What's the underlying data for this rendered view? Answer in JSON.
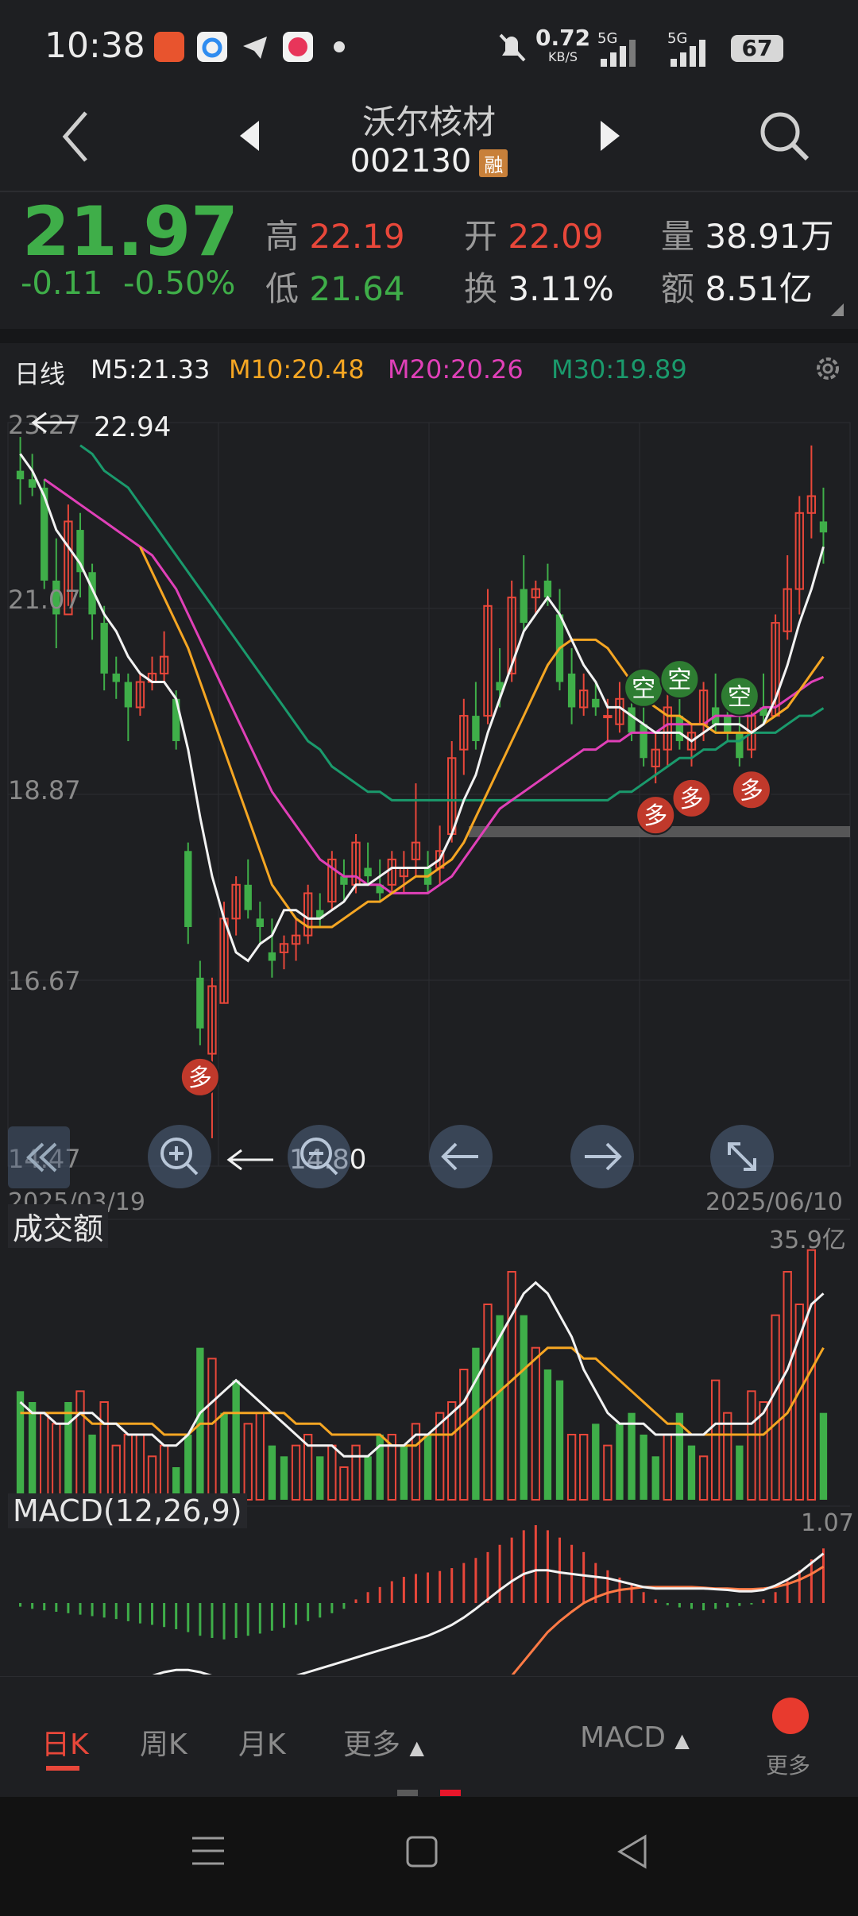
{
  "status": {
    "time": "10:38",
    "net_speed": "0.72",
    "net_unit": "KB/S",
    "signal_1": "5G",
    "signal_2": "5G",
    "battery": "67",
    "icons": [
      "pingan-securities-app-icon",
      "cloud-app-icon",
      "telegram-app-icon",
      "chat-app-icon",
      "dot-icon",
      "mute-bell-icon",
      "signal-icon",
      "signal-icon"
    ]
  },
  "header": {
    "stock_name": "沃尔核材",
    "stock_code": "002130",
    "badge": "融"
  },
  "quote": {
    "price": "21.97",
    "change": "-0.11",
    "change_pct": "-0.50%",
    "high_label": "高",
    "high": "22.19",
    "low_label": "低",
    "low": "21.64",
    "open_label": "开",
    "open": "22.09",
    "turnover_label": "换",
    "turnover": "3.11%",
    "volume_label": "量",
    "volume": "38.91万",
    "amount_label": "额",
    "amount": "8.51亿"
  },
  "ma_bar": {
    "period": "日线",
    "m5": "M5:21.33",
    "m10": "M10:20.48",
    "m20": "M20:20.26",
    "m30": "M30:19.89",
    "colors": {
      "m5": "#f2f2f2",
      "m10": "#f5a623",
      "m20": "#e040b8",
      "m30": "#1a9a6c"
    }
  },
  "chart_data": {
    "type": "candlestick",
    "y_ticks": [
      "23.27",
      "21.07",
      "18.87",
      "16.67",
      "14.47"
    ],
    "ylim": [
      14.47,
      23.27
    ],
    "date_start": "2025/03/19",
    "date_end": "2025/06/10",
    "max_label": "22.94",
    "min_label": "14.80",
    "signal_duo": "多",
    "signal_kong": "空",
    "candles": [
      [
        22.7,
        23.1,
        22.3,
        22.6
      ],
      [
        22.6,
        22.9,
        22.4,
        22.5
      ],
      [
        22.5,
        22.6,
        21.3,
        21.4
      ],
      [
        21.4,
        21.9,
        20.6,
        21.0
      ],
      [
        21.0,
        22.3,
        21.1,
        22.1
      ],
      [
        22.0,
        22.2,
        21.2,
        21.5
      ],
      [
        21.5,
        21.6,
        20.7,
        21.0
      ],
      [
        20.9,
        21.1,
        20.1,
        20.3
      ],
      [
        20.3,
        20.5,
        20.0,
        20.2
      ],
      [
        20.2,
        20.3,
        19.5,
        19.9
      ],
      [
        19.9,
        20.3,
        19.8,
        20.2
      ],
      [
        20.2,
        20.5,
        20.1,
        20.3
      ],
      [
        20.3,
        20.8,
        20.2,
        20.5
      ],
      [
        20.0,
        20.1,
        19.4,
        19.5
      ],
      [
        18.2,
        18.3,
        17.1,
        17.3
      ],
      [
        16.7,
        16.9,
        15.9,
        16.1
      ],
      [
        15.8,
        16.7,
        14.8,
        16.6
      ],
      [
        16.4,
        17.6,
        16.4,
        17.4
      ],
      [
        17.4,
        17.9,
        17.2,
        17.8
      ],
      [
        17.8,
        18.1,
        17.4,
        17.5
      ],
      [
        17.4,
        17.6,
        17.1,
        17.3
      ],
      [
        17.0,
        17.4,
        16.7,
        16.9
      ],
      [
        17.0,
        17.2,
        16.8,
        17.1
      ],
      [
        17.1,
        17.4,
        16.9,
        17.2
      ],
      [
        17.2,
        17.8,
        17.1,
        17.7
      ],
      [
        17.5,
        17.7,
        17.3,
        17.4
      ],
      [
        17.6,
        18.2,
        17.5,
        18.1
      ],
      [
        17.9,
        18.1,
        17.6,
        17.8
      ],
      [
        17.8,
        18.4,
        17.7,
        18.3
      ],
      [
        18.0,
        18.3,
        17.8,
        17.9
      ],
      [
        17.8,
        18.1,
        17.6,
        17.7
      ],
      [
        17.8,
        18.2,
        17.7,
        18.1
      ],
      [
        17.9,
        18.2,
        17.7,
        18.0
      ],
      [
        18.1,
        19.0,
        17.9,
        18.3
      ],
      [
        18.0,
        18.2,
        17.7,
        17.8
      ],
      [
        18.0,
        18.5,
        17.8,
        18.2
      ],
      [
        18.4,
        19.5,
        18.3,
        19.3
      ],
      [
        19.4,
        20.0,
        19.1,
        19.8
      ],
      [
        19.8,
        20.2,
        19.4,
        19.5
      ],
      [
        19.8,
        21.3,
        19.7,
        21.1
      ],
      [
        20.2,
        20.6,
        19.9,
        20.1
      ],
      [
        20.3,
        21.4,
        20.2,
        21.2
      ],
      [
        21.3,
        21.7,
        20.8,
        20.9
      ],
      [
        21.2,
        21.4,
        21.0,
        21.3
      ],
      [
        21.4,
        21.6,
        21.1,
        21.2
      ],
      [
        21.0,
        21.3,
        20.1,
        20.2
      ],
      [
        20.3,
        20.6,
        19.7,
        19.9
      ],
      [
        19.9,
        20.3,
        19.8,
        20.1
      ],
      [
        20.0,
        20.2,
        19.8,
        19.9
      ],
      [
        19.8,
        20.0,
        19.5,
        19.8
      ],
      [
        19.7,
        20.2,
        19.6,
        20.0
      ],
      [
        19.9,
        20.3,
        19.5,
        19.6
      ],
      [
        19.7,
        20.0,
        19.2,
        19.3
      ],
      [
        19.2,
        19.6,
        19.0,
        19.4
      ],
      [
        19.4,
        20.1,
        19.2,
        19.9
      ],
      [
        19.8,
        20.1,
        19.4,
        19.5
      ],
      [
        19.4,
        19.7,
        19.2,
        19.6
      ],
      [
        19.7,
        20.2,
        19.5,
        20.1
      ],
      [
        19.9,
        20.3,
        19.6,
        19.7
      ],
      [
        19.8,
        20.1,
        19.5,
        19.6
      ],
      [
        19.6,
        19.9,
        19.2,
        19.3
      ],
      [
        19.4,
        19.9,
        19.3,
        19.8
      ],
      [
        19.9,
        20.3,
        19.7,
        19.8
      ],
      [
        19.8,
        21.0,
        19.8,
        20.9
      ],
      [
        20.8,
        21.7,
        20.7,
        21.3
      ],
      [
        21.3,
        22.4,
        21.0,
        22.2
      ],
      [
        22.2,
        23.0,
        21.9,
        22.4
      ],
      [
        22.1,
        22.5,
        21.6,
        21.97
      ]
    ],
    "ma5": [
      22.9,
      22.7,
      22.4,
      22.0,
      21.8,
      21.6,
      21.3,
      21.0,
      20.8,
      20.5,
      20.3,
      20.2,
      20.2,
      20.0,
      19.4,
      18.6,
      17.9,
      17.4,
      17.0,
      16.9,
      17.1,
      17.2,
      17.5,
      17.5,
      17.4,
      17.4,
      17.5,
      17.6,
      17.8,
      17.8,
      17.9,
      18.0,
      18.0,
      18.0,
      18.0,
      18.1,
      18.4,
      18.8,
      19.1,
      19.6,
      20.0,
      20.4,
      20.8,
      21.0,
      21.2,
      21.0,
      20.7,
      20.4,
      20.2,
      19.9,
      19.9,
      19.8,
      19.7,
      19.6,
      19.6,
      19.6,
      19.5,
      19.6,
      19.7,
      19.7,
      19.7,
      19.6,
      19.7,
      20.0,
      20.4,
      20.9,
      21.3,
      21.8
    ],
    "ma10": [
      null,
      null,
      null,
      null,
      null,
      null,
      null,
      null,
      null,
      null,
      21.8,
      21.5,
      21.2,
      20.9,
      20.6,
      20.2,
      19.8,
      19.4,
      19.0,
      18.6,
      18.2,
      17.8,
      17.6,
      17.4,
      17.3,
      17.3,
      17.3,
      17.4,
      17.5,
      17.6,
      17.6,
      17.7,
      17.8,
      17.9,
      17.9,
      18.0,
      18.1,
      18.3,
      18.6,
      18.9,
      19.2,
      19.5,
      19.8,
      20.1,
      20.4,
      20.6,
      20.7,
      20.7,
      20.7,
      20.6,
      20.4,
      20.2,
      20.0,
      19.9,
      19.8,
      19.8,
      19.7,
      19.7,
      19.6,
      19.6,
      19.6,
      19.6,
      19.7,
      19.8,
      19.9,
      20.1,
      20.3,
      20.5
    ],
    "ma20": [
      null,
      null,
      22.6,
      22.5,
      22.4,
      22.3,
      22.2,
      22.1,
      22.0,
      21.9,
      21.8,
      21.7,
      21.5,
      21.3,
      21.0,
      20.7,
      20.4,
      20.1,
      19.8,
      19.5,
      19.2,
      18.9,
      18.7,
      18.5,
      18.3,
      18.1,
      18.0,
      17.9,
      17.9,
      17.8,
      17.8,
      17.7,
      17.7,
      17.7,
      17.7,
      17.8,
      17.9,
      18.1,
      18.3,
      18.5,
      18.7,
      18.8,
      18.9,
      19.0,
      19.1,
      19.2,
      19.3,
      19.4,
      19.4,
      19.5,
      19.5,
      19.6,
      19.6,
      19.6,
      19.7,
      19.7,
      19.7,
      19.7,
      19.8,
      19.8,
      19.8,
      19.8,
      19.9,
      19.9,
      20.0,
      20.1,
      20.2,
      20.26
    ],
    "ma30": [
      null,
      null,
      null,
      null,
      null,
      23.0,
      22.9,
      22.7,
      22.6,
      22.5,
      22.3,
      22.1,
      21.9,
      21.7,
      21.5,
      21.3,
      21.1,
      20.9,
      20.7,
      20.5,
      20.3,
      20.1,
      19.9,
      19.7,
      19.5,
      19.4,
      19.2,
      19.1,
      19.0,
      18.9,
      18.9,
      18.8,
      18.8,
      18.8,
      18.8,
      18.8,
      18.8,
      18.8,
      18.8,
      18.8,
      18.8,
      18.8,
      18.8,
      18.8,
      18.8,
      18.8,
      18.8,
      18.8,
      18.8,
      18.8,
      18.9,
      18.9,
      19.0,
      19.1,
      19.2,
      19.3,
      19.3,
      19.4,
      19.4,
      19.5,
      19.5,
      19.6,
      19.6,
      19.6,
      19.7,
      19.8,
      19.8,
      19.89
    ],
    "signals": [
      {
        "type": "duo",
        "index": 15
      },
      {
        "type": "duo",
        "index": 53
      },
      {
        "type": "duo",
        "index": 56
      },
      {
        "type": "duo",
        "index": 61
      },
      {
        "type": "kong",
        "index": 52
      },
      {
        "type": "kong",
        "index": 55
      },
      {
        "type": "kong",
        "index": 60
      }
    ]
  },
  "volume_panel": {
    "title": "成交额",
    "max_label": "35.9亿",
    "bars": [
      10,
      9,
      8,
      7,
      9,
      10,
      6,
      9,
      5,
      6,
      6,
      4,
      5,
      3,
      6,
      14,
      13,
      8,
      11,
      7,
      8,
      5,
      4,
      5,
      6,
      4,
      5,
      3,
      5,
      4,
      6,
      6,
      5,
      7,
      6,
      8,
      9,
      12,
      14,
      18,
      17,
      21,
      17,
      14,
      12,
      11,
      6,
      6,
      7,
      5,
      7,
      8,
      6,
      4,
      6,
      8,
      5,
      4,
      11,
      8,
      5,
      10,
      9,
      17,
      21,
      18,
      23,
      8
    ],
    "bar_up": [
      0,
      0,
      1,
      1,
      0,
      1,
      0,
      1,
      1,
      1,
      1,
      1,
      1,
      0,
      0,
      0,
      1,
      0,
      0,
      1,
      1,
      0,
      0,
      1,
      1,
      0,
      1,
      1,
      1,
      0,
      0,
      1,
      0,
      1,
      0,
      1,
      1,
      1,
      0,
      1,
      0,
      1,
      0,
      1,
      0,
      0,
      1,
      1,
      0,
      1,
      0,
      0,
      0,
      0,
      1,
      0,
      0,
      1,
      1,
      1,
      0,
      1,
      1,
      1,
      1,
      1,
      1,
      0
    ],
    "ma_white": [
      9,
      8,
      8,
      7,
      7,
      8,
      8,
      7,
      7,
      6,
      6,
      6,
      5,
      5,
      6,
      8,
      9,
      10,
      11,
      10,
      9,
      8,
      7,
      6,
      5,
      5,
      5,
      4,
      4,
      4,
      5,
      5,
      5,
      6,
      6,
      7,
      8,
      9,
      11,
      13,
      15,
      17,
      19,
      20,
      19,
      17,
      15,
      12,
      10,
      8,
      7,
      7,
      7,
      6,
      6,
      6,
      6,
      6,
      7,
      7,
      7,
      7,
      8,
      10,
      12,
      15,
      18,
      19
    ],
    "ma_yellow": [
      8,
      8,
      8,
      8,
      8,
      8,
      7,
      7,
      7,
      7,
      7,
      7,
      6,
      6,
      6,
      7,
      7,
      8,
      8,
      8,
      8,
      8,
      8,
      7,
      7,
      7,
      6,
      6,
      6,
      6,
      6,
      5,
      5,
      5,
      6,
      6,
      6,
      7,
      8,
      9,
      10,
      11,
      12,
      13,
      14,
      14,
      14,
      13,
      13,
      12,
      11,
      10,
      9,
      8,
      7,
      7,
      6,
      6,
      6,
      6,
      6,
      6,
      6,
      7,
      8,
      10,
      12,
      14
    ]
  },
  "macd_panel": {
    "title": "MACD(12,26,9)",
    "max_label": "1.07",
    "hist": [
      -0.05,
      -0.08,
      -0.1,
      -0.12,
      -0.14,
      -0.16,
      -0.18,
      -0.2,
      -0.22,
      -0.25,
      -0.28,
      -0.3,
      -0.33,
      -0.36,
      -0.4,
      -0.45,
      -0.48,
      -0.5,
      -0.48,
      -0.45,
      -0.42,
      -0.38,
      -0.34,
      -0.3,
      -0.25,
      -0.2,
      -0.14,
      -0.08,
      0.05,
      0.15,
      0.22,
      0.3,
      0.36,
      0.4,
      0.42,
      0.44,
      0.48,
      0.55,
      0.62,
      0.7,
      0.8,
      0.9,
      1.0,
      1.07,
      1.0,
      0.9,
      0.8,
      0.7,
      0.55,
      0.45,
      0.35,
      0.25,
      0.15,
      0.05,
      -0.03,
      -0.06,
      -0.08,
      -0.1,
      -0.08,
      -0.06,
      -0.04,
      -0.02,
      0.05,
      0.15,
      0.3,
      0.45,
      0.6,
      0.75
    ],
    "dif": [
      null,
      -1.5,
      -1.45,
      -1.4,
      -1.35,
      -1.3,
      -1.25,
      -1.2,
      -1.15,
      -1.1,
      -1.05,
      -1.0,
      -0.95,
      -0.92,
      -0.92,
      -0.95,
      -1.0,
      -1.05,
      -1.1,
      -1.12,
      -1.12,
      -1.1,
      -1.05,
      -1.0,
      -0.95,
      -0.9,
      -0.85,
      -0.8,
      -0.75,
      -0.7,
      -0.65,
      -0.6,
      -0.55,
      -0.5,
      -0.45,
      -0.38,
      -0.3,
      -0.2,
      -0.08,
      0.05,
      0.18,
      0.3,
      0.4,
      0.45,
      0.45,
      0.42,
      0.4,
      0.38,
      0.36,
      0.34,
      0.3,
      0.26,
      0.22,
      0.2,
      0.2,
      0.2,
      0.2,
      0.2,
      0.19,
      0.18,
      0.16,
      0.16,
      0.18,
      0.24,
      0.32,
      0.42,
      0.55,
      0.68
    ],
    "dea": [
      null,
      null,
      null,
      null,
      null,
      null,
      null,
      null,
      null,
      null,
      null,
      null,
      null,
      null,
      null,
      null,
      null,
      null,
      null,
      null,
      null,
      null,
      null,
      null,
      null,
      null,
      null,
      null,
      null,
      null,
      null,
      null,
      null,
      null,
      null,
      null,
      null,
      null,
      null,
      null,
      null,
      -1.0,
      -0.8,
      -0.6,
      -0.4,
      -0.25,
      -0.12,
      0.0,
      0.08,
      0.14,
      0.18,
      0.2,
      0.22,
      0.22,
      0.22,
      0.22,
      0.22,
      0.21,
      0.2,
      0.2,
      0.19,
      0.19,
      0.2,
      0.22,
      0.26,
      0.32,
      0.4,
      0.5
    ]
  },
  "tabs": {
    "daily": "日K",
    "weekly": "周K",
    "monthly": "月K",
    "more": "更多",
    "indicator": "MACD",
    "more_right": "更多"
  },
  "colors": {
    "up": "#e8473a",
    "down": "#3fae49",
    "bg": "#1e1f22"
  }
}
